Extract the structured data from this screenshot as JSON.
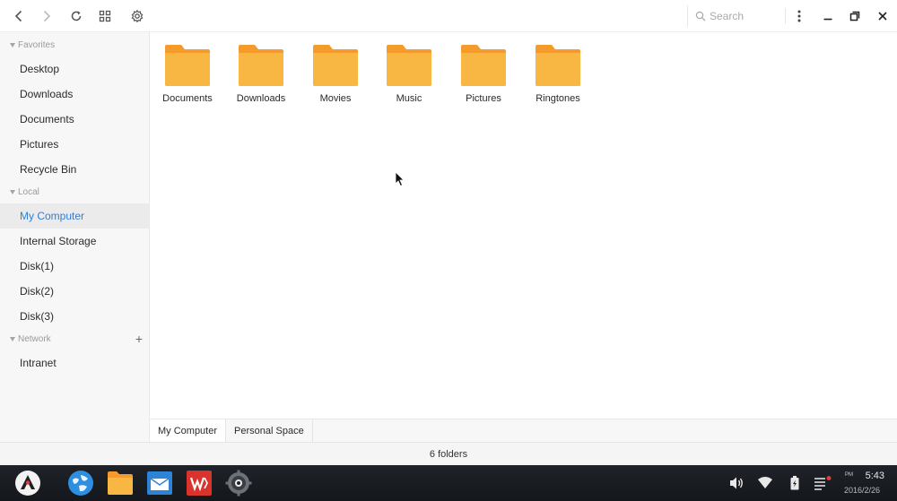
{
  "toolbar": {
    "search_placeholder": "Search",
    "icons": [
      "back-icon",
      "forward-icon",
      "refresh-icon",
      "grid-view-icon",
      "settings-icon",
      "more-icon",
      "minimize-icon",
      "restore-icon",
      "close-icon"
    ]
  },
  "sidebar": {
    "favorites": {
      "title": "Favorites",
      "items": [
        "Desktop",
        "Downloads",
        "Documents",
        "Pictures",
        "Recycle Bin"
      ]
    },
    "local": {
      "title": "Local",
      "items": [
        "My Computer",
        "Internal Storage",
        "Disk(1)",
        "Disk(2)",
        "Disk(3)"
      ],
      "active": "My Computer"
    },
    "network": {
      "title": "Network",
      "add_label": "+",
      "items": [
        "Intranet"
      ]
    }
  },
  "folders": [
    {
      "label": "Documents"
    },
    {
      "label": "Downloads"
    },
    {
      "label": "Movies"
    },
    {
      "label": "Music"
    },
    {
      "label": "Pictures"
    },
    {
      "label": "Ringtones"
    }
  ],
  "tabs": [
    "My Computer",
    "Personal Space"
  ],
  "status": {
    "text": "6 folders"
  },
  "taskbar": {
    "apps": [
      "start-menu-icon",
      "browser-icon",
      "file-manager-icon",
      "mail-icon",
      "wps-office-icon",
      "settings-app-icon"
    ],
    "tray": [
      "volume-icon",
      "wifi-icon",
      "battery-icon",
      "notifications-icon"
    ],
    "clock": {
      "ampm": "PM",
      "time": "5:43",
      "date": "2016/2/26"
    }
  },
  "colors": {
    "accent": "#2f7fd8",
    "folder": "#f7b742",
    "folder_tab": "#f59b2c",
    "taskbar": "#1a1e23"
  }
}
